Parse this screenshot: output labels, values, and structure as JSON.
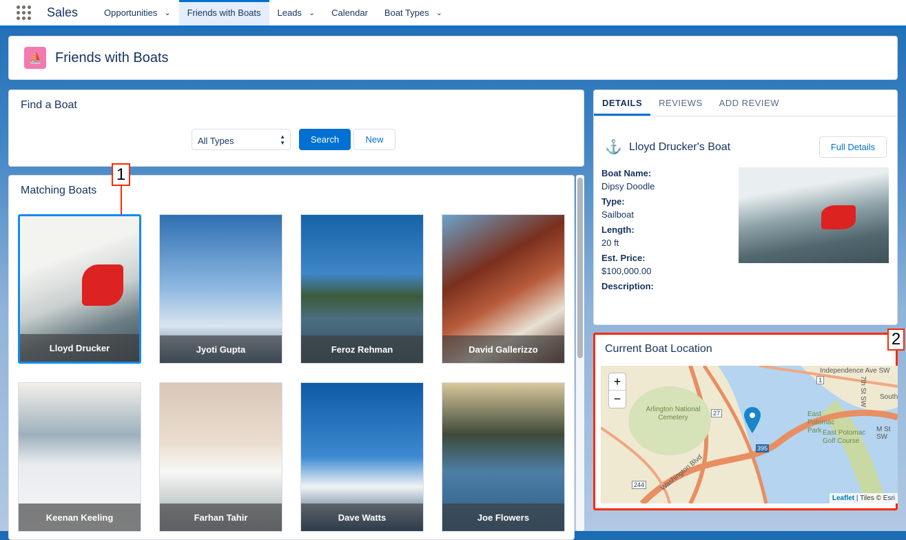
{
  "nav": {
    "app": "Sales",
    "items": [
      {
        "label": "Opportunities",
        "dropdown": true
      },
      {
        "label": "Friends with Boats",
        "active": true
      },
      {
        "label": "Leads",
        "dropdown": true
      },
      {
        "label": "Calendar"
      },
      {
        "label": "Boat Types",
        "dropdown": true
      }
    ]
  },
  "header": {
    "title": "Friends with Boats"
  },
  "find": {
    "title": "Find a Boat",
    "select_value": "All Types",
    "search": "Search",
    "new": "New"
  },
  "matching": {
    "title": "Matching Boats",
    "boats": [
      "Lloyd Drucker",
      "Jyoti Gupta",
      "Feroz Rehman",
      "David Gallerizzo",
      "Keenan Keeling",
      "Farhan Tahir",
      "Dave Watts",
      "Joe Flowers"
    ]
  },
  "details": {
    "tabs": [
      "DETAILS",
      "REVIEWS",
      "ADD REVIEW"
    ],
    "title": "Lloyd Drucker's Boat",
    "full_details": "Full Details",
    "fields": [
      {
        "label": "Boat Name:",
        "value": "Dipsy Doodle"
      },
      {
        "label": "Type:",
        "value": "Sailboat"
      },
      {
        "label": "Length:",
        "value": "20 ft"
      },
      {
        "label": "Est. Price:",
        "value": "$100,000.00"
      },
      {
        "label": "Description:",
        "value": ""
      }
    ]
  },
  "map": {
    "title": "Current Boat Location",
    "zoom_in": "+",
    "zoom_out": "−",
    "leaflet": "Leaflet",
    "tiles": "| Tiles © Esri",
    "labels": [
      "Arlington National Cemetery",
      "East Potomac Park",
      "East Potomac Golf Course",
      "Washington Blvd",
      "Independence Ave SW",
      "M St SW",
      "7th St SW",
      "South",
      "27",
      "1",
      "395",
      "244"
    ]
  },
  "annotations": [
    "1",
    "2"
  ],
  "colors": {
    "brand": "#0070d2",
    "annotation": "#ff2a00",
    "header_icon": "#f27aaf"
  }
}
